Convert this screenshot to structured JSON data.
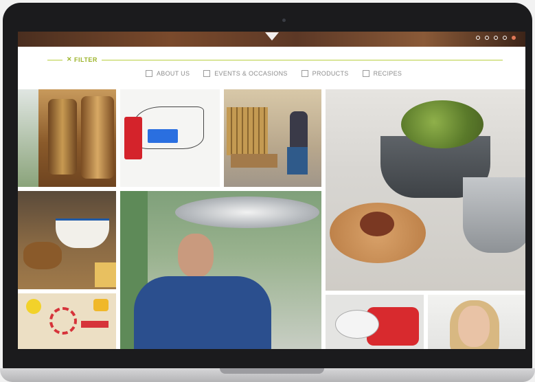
{
  "filter": {
    "label": "FILTER",
    "options": [
      {
        "label": "ABOUT US",
        "checked": false
      },
      {
        "label": "EVENTS & OCCASIONS",
        "checked": false
      },
      {
        "label": "PRODUCTS",
        "checked": false
      },
      {
        "label": "RECIPES",
        "checked": false
      }
    ]
  },
  "carousel": {
    "slide_count": 5,
    "active_slide": 5
  },
  "colors": {
    "accent": "#9cb42a",
    "active_dot": "#e07858"
  },
  "tiles": [
    "bronze-bells",
    "product-sketch",
    "warehouse-worker",
    "artichoke-pots-food",
    "cheese-fondue",
    "factory-worker",
    "kitchen-tools",
    "red-pot",
    "portrait"
  ]
}
